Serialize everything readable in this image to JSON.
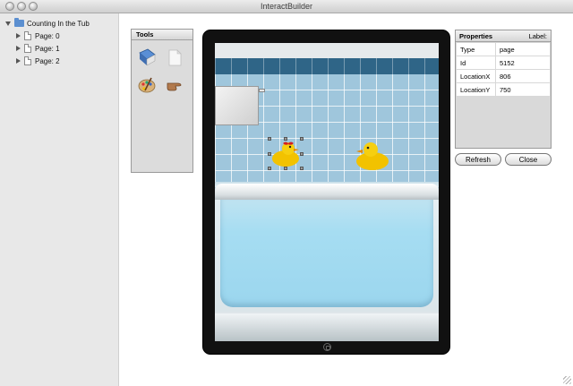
{
  "window": {
    "title": "InteractBuilder"
  },
  "tree": {
    "root": {
      "label": "Counting In the Tub",
      "icon": "folder-icon"
    },
    "pages": [
      {
        "label": "Page: 0",
        "icon": "page-icon"
      },
      {
        "label": "Page: 1",
        "icon": "page-icon"
      },
      {
        "label": "Page: 2",
        "icon": "page-icon"
      }
    ]
  },
  "tools": {
    "title": "Tools",
    "items": [
      "book-icon",
      "blank-page-icon",
      "palette-icon",
      "pointing-hand-icon"
    ]
  },
  "properties": {
    "title": "Properties",
    "label_caption": "Label:",
    "rows": [
      {
        "key": "Type",
        "value": "page"
      },
      {
        "key": "Id",
        "value": "5152"
      },
      {
        "key": "LocationX",
        "value": "806"
      },
      {
        "key": "LocationY",
        "value": "750"
      }
    ]
  },
  "buttons": {
    "refresh": "Refresh",
    "close": "Close"
  },
  "colors": {
    "tile": "#9fc6dc",
    "tile_dark": "#2f6587",
    "water": "#a6ddf2",
    "duck": "#f2c200"
  }
}
